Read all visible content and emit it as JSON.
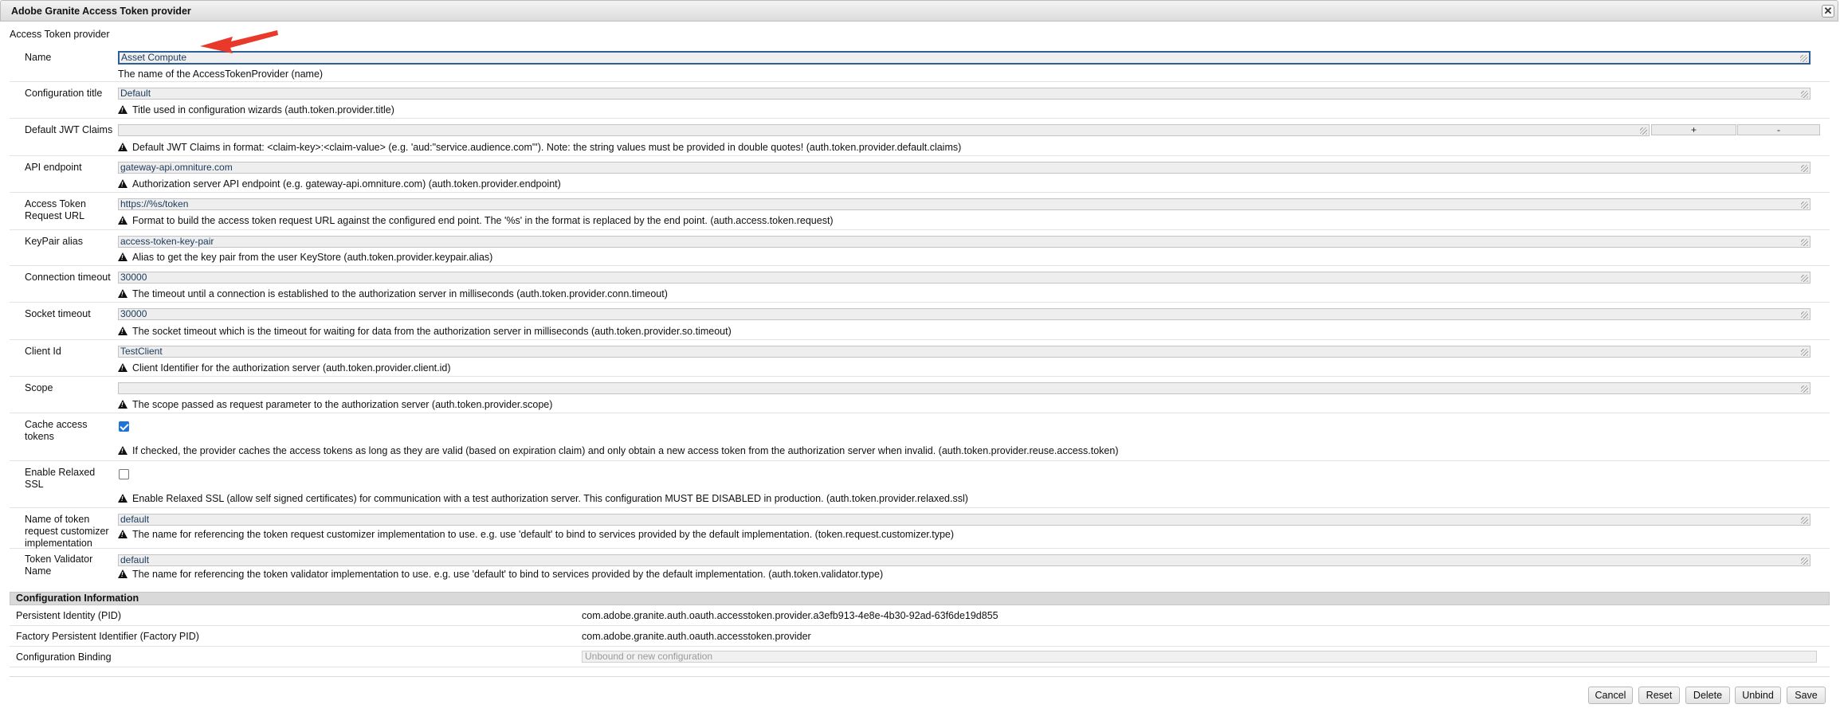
{
  "dialog": {
    "title": "Adobe Granite Access Token provider",
    "close_glyph": "✕",
    "subtitle": "Access Token provider"
  },
  "fields": {
    "name": {
      "label": "Name",
      "value": "Asset Compute",
      "desc": "The name of the AccessTokenProvider (name)"
    },
    "config_title": {
      "label": "Configuration title",
      "value": "Default",
      "desc": "Title used in configuration wizards (auth.token.provider.title)"
    },
    "jwt_claims": {
      "label": "Default JWT Claims",
      "value": "",
      "plus": "+",
      "minus": "-",
      "desc": "Default JWT Claims in format: <claim-key>:<claim-value> (e.g. 'aud:\"service.audience.com\"'). Note: the string values must be provided in double quotes! (auth.token.provider.default.claims)"
    },
    "api_endpoint": {
      "label": "API endpoint",
      "value": "gateway-api.omniture.com",
      "desc": "Authorization server API endpoint (e.g. gateway-api.omniture.com) (auth.token.provider.endpoint)"
    },
    "token_request_url": {
      "label": "Access Token Request URL",
      "value": "https://%s/token",
      "desc": "Format to build the access token request URL against the configured end point. The '%s' in the format is replaced by the end point. (auth.access.token.request)"
    },
    "keypair_alias": {
      "label": "KeyPair alias",
      "value": "access-token-key-pair",
      "desc": "Alias to get the key pair from the user KeyStore (auth.token.provider.keypair.alias)"
    },
    "conn_timeout": {
      "label": "Connection timeout",
      "value": "30000",
      "desc": "The timeout until a connection is established to the authorization server in milliseconds (auth.token.provider.conn.timeout)"
    },
    "socket_timeout": {
      "label": "Socket timeout",
      "value": "30000",
      "desc": "The socket timeout which is the timeout for waiting for data from the authorization server in milliseconds (auth.token.provider.so.timeout)"
    },
    "client_id": {
      "label": "Client Id",
      "value": "TestClient",
      "desc": "Client Identifier for the authorization server (auth.token.provider.client.id)"
    },
    "scope": {
      "label": "Scope",
      "value": "",
      "desc": "The scope passed as request parameter to the authorization server (auth.token.provider.scope)"
    },
    "cache_tokens": {
      "label": "Cache access tokens",
      "checked": true,
      "desc": "If checked, the provider caches the access tokens as long as they are valid (based on expiration claim) and only obtain a new access token from the authorization server when invalid. (auth.token.provider.reuse.access.token)"
    },
    "relaxed_ssl": {
      "label": "Enable Relaxed SSL",
      "checked": false,
      "desc": "Enable Relaxed SSL (allow self signed certificates) for communication with a test authorization server. This configuration MUST BE DISABLED in production. (auth.token.provider.relaxed.ssl)"
    },
    "customizer": {
      "label": "Name of token request customizer implementation",
      "value": "default",
      "desc": "The name for referencing the token request customizer implementation to use. e.g. use 'default' to bind to services provided by the default implementation. (token.request.customizer.type)"
    },
    "validator": {
      "label": "Token Validator Name",
      "value": "default",
      "desc": "The name for referencing the token validator implementation to use. e.g. use 'default' to bind to services provided by the default implementation. (auth.token.validator.type)"
    }
  },
  "config_info": {
    "heading": "Configuration Information",
    "pid_label": "Persistent Identity (PID)",
    "pid_value": "com.adobe.granite.auth.oauth.accesstoken.provider.a3efb913-4e8e-4b30-92ad-63f6de19d855",
    "factory_label": "Factory Persistent Identifier (Factory PID)",
    "factory_value": "com.adobe.granite.auth.oauth.accesstoken.provider",
    "binding_label": "Configuration Binding",
    "binding_placeholder": "Unbound or new configuration"
  },
  "buttons": {
    "cancel": "Cancel",
    "reset": "Reset",
    "delete": "Delete",
    "unbind": "Unbind",
    "save": "Save"
  },
  "colors": {
    "checkbox_on": "#1f72d6",
    "annotation_arrow": "#e8392a",
    "focus_border": "#2a5f9a"
  }
}
